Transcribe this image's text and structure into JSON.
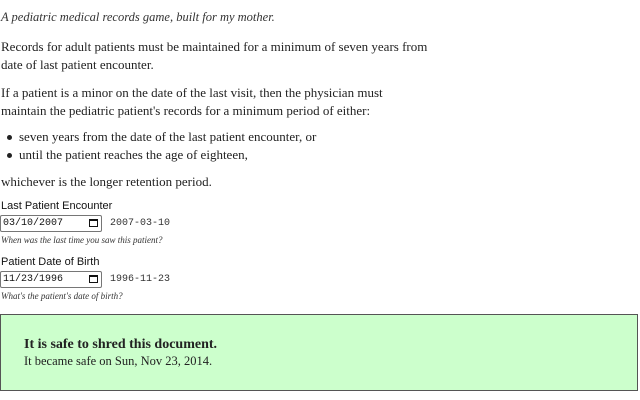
{
  "intro": {
    "tagline": "A pediatric medical records game, built for my mother.",
    "paragraph1": "Records for adult patients must be maintained for a minimum of seven years from date of last patient encounter.",
    "paragraph2": "If a patient is a minor on the date of the last visit, then the physician must maintain the pediatric patient's records for a minimum period of either:",
    "bullets": [
      "seven years from the date of the last patient encounter, or",
      "until the patient reaches the age of eighteen,"
    ],
    "paragraph3": "whichever is the longer retention period."
  },
  "form": {
    "last_encounter": {
      "label": "Last Patient Encounter",
      "value": "03/10/2007",
      "iso": "2007-03-10",
      "hint": "When was the last time you saw this patient?",
      "icon": "calendar-icon"
    },
    "birth_date": {
      "label": "Patient Date of Birth",
      "value": "11/23/1996",
      "iso": "1996-11-23",
      "hint": "What's the patient's date of birth?",
      "icon": "calendar-icon"
    }
  },
  "result": {
    "title": "It is safe to shred this document.",
    "text": "It became safe on Sun, Nov 23, 2014.",
    "background_color": "#ccffcc"
  }
}
